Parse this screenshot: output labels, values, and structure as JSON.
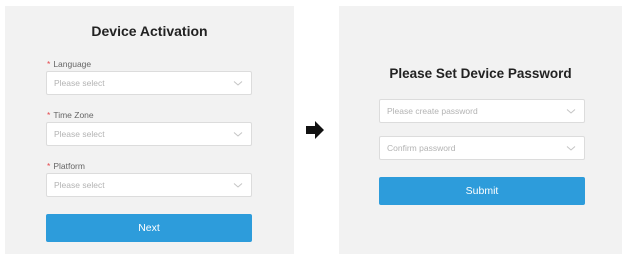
{
  "activation": {
    "title": "Device Activation",
    "fields": [
      {
        "label": "Language",
        "placeholder": "Please select"
      },
      {
        "label": "Time Zone",
        "placeholder": "Please select"
      },
      {
        "label": "Platform",
        "placeholder": "Please select"
      }
    ],
    "required_mark": "*",
    "next_label": "Next"
  },
  "password": {
    "title": "Please Set Device Password",
    "create_placeholder": "Please create password",
    "confirm_placeholder": "Confirm password",
    "submit_label": "Submit"
  },
  "colors": {
    "panel_bg": "#f2f2f2",
    "primary": "#2d9cdb",
    "required": "#e5484d"
  },
  "icons": {
    "dropdown": "chevron-down-icon",
    "flow": "arrow-right-icon"
  }
}
